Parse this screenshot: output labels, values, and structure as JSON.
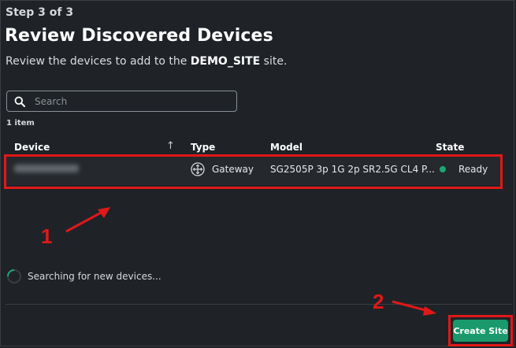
{
  "wizard": {
    "step": "Step 3 of 3",
    "title": "Review Discovered Devices",
    "subtitle_prefix": "Review the devices to add to the ",
    "site_name": "DEMO_SITE",
    "subtitle_suffix": " site."
  },
  "search": {
    "placeholder": "Search",
    "value": ""
  },
  "table": {
    "item_count": "1 item",
    "columns": [
      "Device",
      "Type",
      "Model",
      "State"
    ],
    "sort_indicator": "↑",
    "rows": [
      {
        "device": "",
        "type": "Gateway",
        "model": "SG2505P 3p 1G 2p SR2.5G CL4 P...",
        "state": "Ready"
      }
    ]
  },
  "status": {
    "searching": "Searching for new devices..."
  },
  "footer": {
    "create_label": "Create Site"
  },
  "annotations": {
    "label1": "1",
    "label2": "2"
  },
  "colors": {
    "background": "#1f2327",
    "accent": "#1a9a6c",
    "ready": "#1ea672",
    "annotation": "#e01818"
  }
}
